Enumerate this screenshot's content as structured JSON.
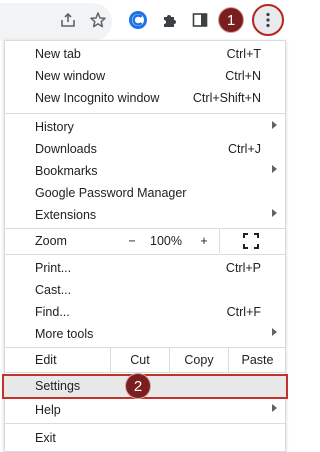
{
  "toolbar": {
    "share_icon": "share-icon",
    "bookmark_icon": "star-icon",
    "extension_c_icon": "extension-c-icon",
    "extensions_icon": "puzzle-icon",
    "side_panel_icon": "side-panel-icon",
    "menu_icon": "three-dots-icon"
  },
  "step_badges": {
    "step1": "1",
    "step2": "2"
  },
  "menu": {
    "new_tab": {
      "label": "New tab",
      "shortcut": "Ctrl+T"
    },
    "new_window": {
      "label": "New window",
      "shortcut": "Ctrl+N"
    },
    "new_incognito": {
      "label": "New Incognito window",
      "shortcut": "Ctrl+Shift+N"
    },
    "history": {
      "label": "History"
    },
    "downloads": {
      "label": "Downloads",
      "shortcut": "Ctrl+J"
    },
    "bookmarks": {
      "label": "Bookmarks"
    },
    "password_manager": {
      "label": "Google Password Manager"
    },
    "extensions": {
      "label": "Extensions"
    },
    "zoom": {
      "label": "Zoom",
      "minus": "−",
      "value": "100%",
      "plus": "+"
    },
    "print": {
      "label": "Print...",
      "shortcut": "Ctrl+P"
    },
    "cast": {
      "label": "Cast..."
    },
    "find": {
      "label": "Find...",
      "shortcut": "Ctrl+F"
    },
    "more_tools": {
      "label": "More tools"
    },
    "edit": {
      "label": "Edit",
      "cut": "Cut",
      "copy": "Copy",
      "paste": "Paste"
    },
    "settings": {
      "label": "Settings"
    },
    "help": {
      "label": "Help"
    },
    "exit": {
      "label": "Exit"
    }
  },
  "colors": {
    "highlight_border": "#c3322a",
    "badge_fill": "#7b1e1e",
    "extension_blue": "#1a73e8"
  }
}
